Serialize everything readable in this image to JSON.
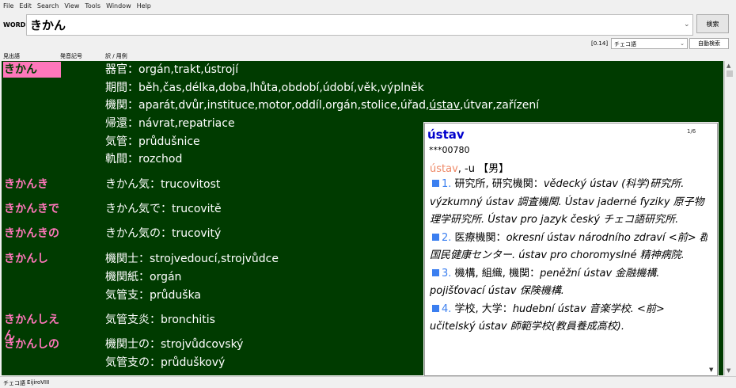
{
  "menu": [
    "File",
    "Edit",
    "Search",
    "View",
    "Tools",
    "Window",
    "Help"
  ],
  "word_label": "WORD",
  "word_value": "きかん",
  "search_button": "検索",
  "count": "[0.14]",
  "language": "チェコ語",
  "auto_search": "自動検索",
  "columns": {
    "headword": "見出語",
    "pronunciation": "発音記号",
    "translation": "訳 / 用例"
  },
  "entries": [
    {
      "headword": "きかん",
      "selected": true,
      "lines": [
        "器官：orgán,trakt,ústrojí",
        "期間：běh,čas,délka,doba,lhůta,období,údobí,věk,výplněk",
        "機関：aparát,dvůr,instituce,motor,oddíl,orgán,stolice,úřad,ústav,útvar,zařízení",
        "帰還：návrat,repatriace",
        "気管：průdušnice",
        "軌間：rozchod"
      ]
    },
    {
      "headword": "きかんき",
      "lines": [
        "きかん気：trucovitost"
      ]
    },
    {
      "headword": "きかんきで",
      "lines": [
        "きかん気で：trucovitě"
      ]
    },
    {
      "headword": "きかんきの",
      "lines": [
        "きかん気の：trucovitý"
      ]
    },
    {
      "headword": "きかんし",
      "lines": [
        "機関士：strojvedoucí,strojvůdce",
        "機関紙：orgán",
        "気管支：průduška"
      ]
    },
    {
      "headword": "きかんしえん",
      "lines": [
        "気管支炎：bronchitis"
      ]
    },
    {
      "headword": "きかんしの",
      "lines": [
        "機関士の：strojvůdcovský",
        "気管支の：průduškový"
      ]
    }
  ],
  "popup": {
    "title": "ústav",
    "page": "1/6",
    "id": "***00780",
    "lemma": "ústav",
    "inflection": ", -u 【男】",
    "senses": [
      {
        "num": "1.",
        "def": "研究所, 研究機関：",
        "ex": "vědecký ústav (科学)研究所. výzkumný ústav 調査機関. Ústav jaderné fyziky 原子物理学研究所. Ústav pro jazyk český チェコ語研究所."
      },
      {
        "num": "2.",
        "def": "医療機関：",
        "ex": "okresní ústav národního zdraví <前> 郡国民健康センター. ústav pro choromyslné 精神病院."
      },
      {
        "num": "3.",
        "def": "機構, 組織, 機関：",
        "ex": "peněžní ústav 金融機構. pojišťovací ústav 保険機構."
      },
      {
        "num": "4.",
        "def": "学校, 大学：",
        "ex": "hudební ústav 音楽学校. <前> učitelský ústav 師範学校(教員養成高校)."
      }
    ]
  },
  "status": {
    "language": "チェコ語",
    "dictionary": "EijiroVIII"
  }
}
